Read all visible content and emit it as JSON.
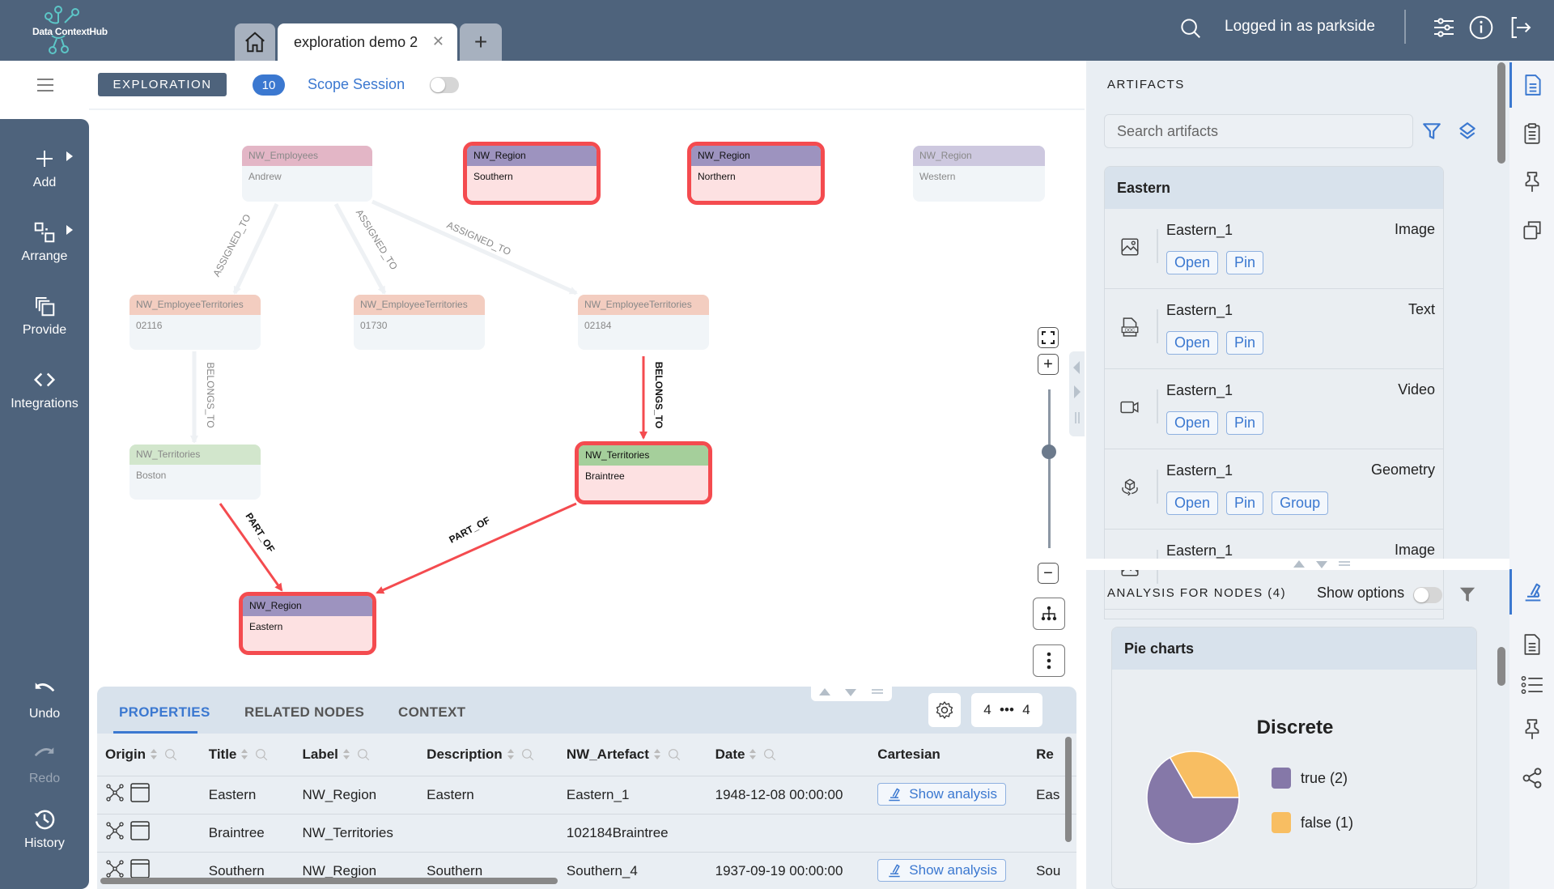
{
  "app": {
    "name": "Data ContextHub",
    "tabs": [
      {
        "label": "exploration demo 2",
        "active": true
      }
    ],
    "home_icon": "home-icon",
    "add_tab_icon": "plus-icon",
    "logged_in_text": "Logged in as parkside",
    "top_icons": [
      "search-icon",
      "settings-sliders-icon",
      "info-icon",
      "logout-icon"
    ]
  },
  "toolbar": {
    "mode": "EXPLORATION",
    "count": "10",
    "scope_label": "Scope Session",
    "scope_enabled": false
  },
  "sidebar": {
    "items": [
      {
        "label": "Add",
        "icon": "plus-icon",
        "has_submenu": true
      },
      {
        "label": "Arrange",
        "icon": "arrange-icon",
        "has_submenu": true
      },
      {
        "label": "Provide",
        "icon": "provide-icon",
        "has_submenu": false
      },
      {
        "label": "Integrations",
        "icon": "code-icon",
        "has_submenu": false
      }
    ],
    "bottom_items": [
      {
        "label": "Undo",
        "icon": "undo-icon",
        "enabled": true
      },
      {
        "label": "Redo",
        "icon": "redo-icon",
        "enabled": false
      },
      {
        "label": "History",
        "icon": "history-icon",
        "enabled": true
      }
    ]
  },
  "graph": {
    "colors": {
      "selected_border": "#f44b4f",
      "selected_fill": "#fde1e2",
      "region_header": "#9d93bf",
      "region_header_faded": "#cdc8df",
      "employees_header": "#e3b6c6",
      "employee_territories_header": "#f3cdc0",
      "territories_header": "#a5cf9b",
      "territories_header_faded": "#d2e6cc",
      "edge_highlight": "#f44b4f",
      "edge_faded": "#eef1f4"
    },
    "nodes": [
      {
        "id": "andrew",
        "type": "NW_Employees",
        "title": "Andrew",
        "selected": false
      },
      {
        "id": "southern",
        "type": "NW_Region",
        "title": "Southern",
        "selected": true
      },
      {
        "id": "northern",
        "type": "NW_Region",
        "title": "Northern",
        "selected": true
      },
      {
        "id": "western",
        "type": "NW_Region",
        "title": "Western",
        "selected": false
      },
      {
        "id": "et02116",
        "type": "NW_EmployeeTerritories",
        "title": "02116",
        "selected": false
      },
      {
        "id": "et01730",
        "type": "NW_EmployeeTerritories",
        "title": "01730",
        "selected": false
      },
      {
        "id": "et02184",
        "type": "NW_EmployeeTerritories",
        "title": "02184",
        "selected": false
      },
      {
        "id": "boston",
        "type": "NW_Territories",
        "title": "Boston",
        "selected": false
      },
      {
        "id": "braintree",
        "type": "NW_Territories",
        "title": "Braintree",
        "selected": true
      },
      {
        "id": "eastern",
        "type": "NW_Region",
        "title": "Eastern",
        "selected": true
      }
    ],
    "edges": [
      {
        "from": "andrew",
        "to": "et02116",
        "label": "ASSIGNED_TO",
        "highlighted": false
      },
      {
        "from": "andrew",
        "to": "et01730",
        "label": "ASSIGNED_TO",
        "highlighted": false
      },
      {
        "from": "andrew",
        "to": "et02184",
        "label": "ASSIGNED_TO",
        "highlighted": false
      },
      {
        "from": "et02116",
        "to": "boston",
        "label": "BELONGS_TO",
        "highlighted": false
      },
      {
        "from": "et02184",
        "to": "braintree",
        "label": "BELONGS_TO",
        "highlighted": true
      },
      {
        "from": "boston",
        "to": "eastern",
        "label": "PART_OF",
        "highlighted": true
      },
      {
        "from": "braintree",
        "to": "eastern",
        "label": "PART_OF",
        "highlighted": true
      }
    ],
    "zoom_level": 0.65,
    "controls": [
      "fit-screen-icon",
      "zoom-in-icon",
      "zoom-out-icon",
      "hierarchy-layout-icon",
      "more-vertical-icon"
    ]
  },
  "bottom_panel": {
    "tabs": [
      {
        "label": "PROPERTIES",
        "active": true
      },
      {
        "label": "RELATED NODES",
        "active": false
      },
      {
        "label": "CONTEXT",
        "active": false
      }
    ],
    "pager": {
      "current": "4",
      "total": "4"
    },
    "columns": [
      "Origin",
      "Title",
      "Label",
      "Description",
      "NW_Artefact",
      "Date",
      "Cartesian",
      "Re"
    ],
    "rows": [
      {
        "title": "Eastern",
        "label": "NW_Region",
        "description": "Eastern",
        "artefact": "Eastern_1",
        "date": "1948-12-08 00:00:00",
        "cartesian": "Show analysis",
        "re": "Eas"
      },
      {
        "title": "Braintree",
        "label": "NW_Territories",
        "description": "",
        "artefact": "102184Braintree",
        "date": "",
        "cartesian": "",
        "re": ""
      },
      {
        "title": "Southern",
        "label": "NW_Region",
        "description": "Southern",
        "artefact": "Southern_4",
        "date": "1937-09-19 00:00:00",
        "cartesian": "Show analysis",
        "re": "Sou"
      }
    ]
  },
  "artifacts": {
    "title": "ARTIFACTS",
    "search_placeholder": "Search artifacts",
    "group": "Eastern",
    "items": [
      {
        "name": "Eastern_1",
        "type": "Image",
        "icon": "image-icon",
        "actions": [
          "Open",
          "Pin"
        ]
      },
      {
        "name": "Eastern_1",
        "type": "Text",
        "icon": "doc-file-icon",
        "actions": [
          "Open",
          "Pin"
        ]
      },
      {
        "name": "Eastern_1",
        "type": "Video",
        "icon": "video-icon",
        "actions": [
          "Open",
          "Pin"
        ]
      },
      {
        "name": "Eastern_1",
        "type": "Geometry",
        "icon": "cube-rotate-icon",
        "actions": [
          "Open",
          "Pin",
          "Group"
        ]
      },
      {
        "name": "Eastern_1",
        "type": "Image",
        "icon": "image-icon",
        "actions": []
      }
    ]
  },
  "analysis": {
    "title": "ANALYSIS FOR NODES (4)",
    "show_options_label": "Show options",
    "show_options_enabled": false,
    "card_title": "Pie charts"
  },
  "chart_data": {
    "type": "pie",
    "title": "Discrete",
    "categories": [
      "true",
      "false"
    ],
    "values": [
      2,
      1
    ],
    "legend": [
      "true (2)",
      "false (1)"
    ],
    "colors": [
      "#8578a8",
      "#f8be62"
    ],
    "legend_position": "right"
  },
  "icon_strip": {
    "top": [
      "document-icon",
      "clipboard-icon",
      "pin-icon",
      "copy-icon"
    ],
    "bottom": [
      "microscope-icon",
      "document-icon",
      "list-icon",
      "pin-icon",
      "share-icon"
    ]
  }
}
